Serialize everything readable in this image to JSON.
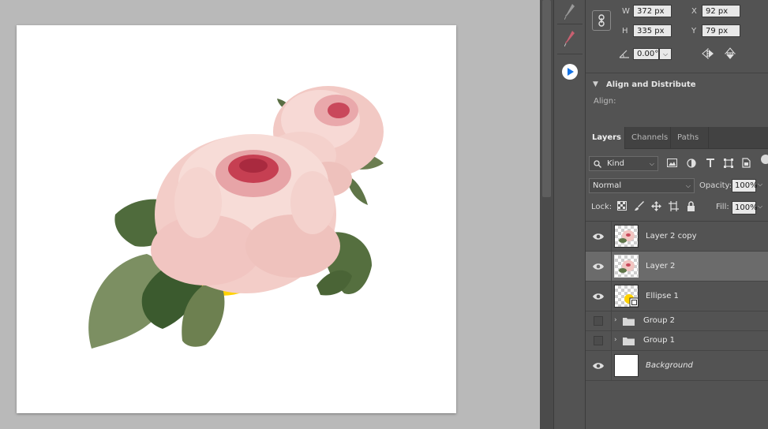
{
  "properties": {
    "w_label": "W",
    "w_value": "372 px",
    "h_label": "H",
    "h_value": "335 px",
    "x_label": "X",
    "x_value": "92 px",
    "y_label": "Y",
    "y_value": "79 px",
    "angle_value": "0.00°"
  },
  "align": {
    "title": "Align and Distribute",
    "label": "Align:"
  },
  "layers_panel": {
    "tabs": [
      {
        "label": "Layers"
      },
      {
        "label": "Channels"
      },
      {
        "label": "Paths"
      }
    ],
    "filter_kind": "Kind",
    "blend_mode": "Normal",
    "opacity_label": "Opacity:",
    "opacity_value": "100%",
    "lock_label": "Lock:",
    "fill_label": "Fill:",
    "fill_value": "100%",
    "layers": [
      {
        "name": "Layer 2 copy",
        "type": "pixel",
        "visible": true
      },
      {
        "name": "Layer 2",
        "type": "pixel",
        "visible": true,
        "selected": true
      },
      {
        "name": "Ellipse 1",
        "type": "shape",
        "visible": true
      },
      {
        "name": "Group 2",
        "type": "group",
        "visible": false
      },
      {
        "name": "Group 1",
        "type": "group",
        "visible": false
      },
      {
        "name": "Background",
        "type": "background",
        "visible": true
      }
    ]
  },
  "icons": {
    "link": "link-icon",
    "eye": "eye-icon",
    "folder": "folder-icon",
    "play": "play-icon",
    "eyedropper": "eyedropper-icon"
  },
  "colors": {
    "accent_blue": "#1473e6",
    "ellipse_yellow": "#ffd200"
  }
}
